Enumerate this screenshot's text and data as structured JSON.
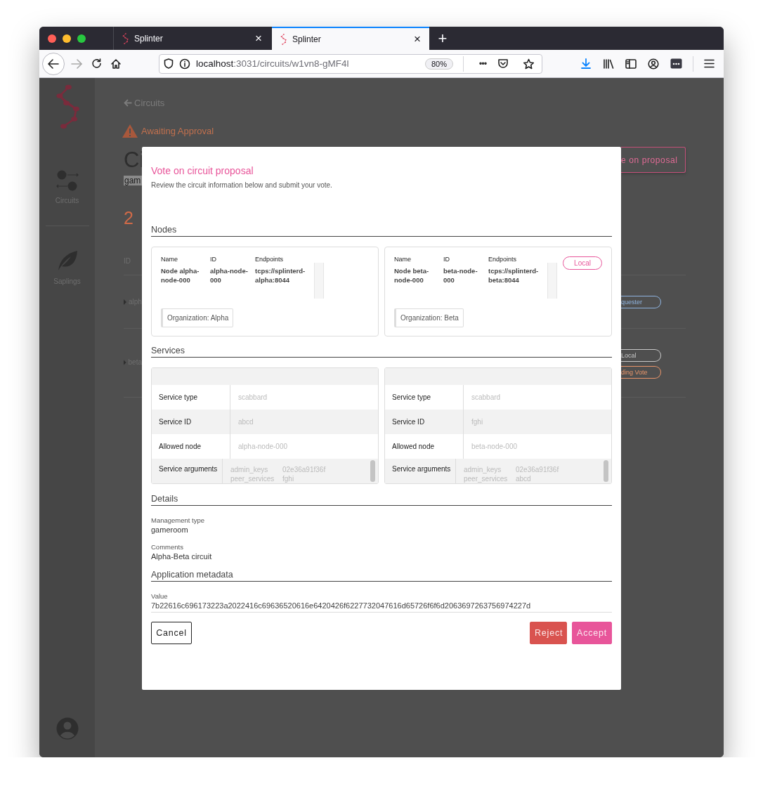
{
  "browser": {
    "tabs": [
      {
        "title": "Splinter",
        "selected": false,
        "close": "×"
      },
      {
        "title": "Splinter",
        "selected": true,
        "close": "×"
      }
    ],
    "new_tab": "+",
    "address": {
      "host": "localhost",
      "path": ":3031/circuits/w1vn8-gMF4l"
    },
    "zoom": "80%",
    "page_actions": "•••"
  },
  "sidebar": {
    "items": [
      {
        "label": "Circuits",
        "kind": "circuits"
      },
      {
        "label": "Saplings",
        "kind": "saplings"
      }
    ]
  },
  "page": {
    "back_link": "Circuits",
    "status": "Awaiting Approval",
    "title": "Ci",
    "subtitle": "gam",
    "count": "2",
    "action_button": "e on proposal",
    "table": {
      "column": "ID",
      "rows": [
        {
          "id": "alph",
          "badges": [
            {
              "label": "quester",
              "color": "#8fb4e0"
            }
          ]
        },
        {
          "id": "beta",
          "badges": [
            {
              "label": "Local",
              "color": "#c8c8c8"
            },
            {
              "label": "ding Vote",
              "color": "#e8956a"
            }
          ]
        }
      ]
    }
  },
  "dialog": {
    "title": "Vote on circuit proposal",
    "subtitle": "Review the circuit information below and submit your vote.",
    "nodes": {
      "heading": "Nodes",
      "items": [
        {
          "columns": [
            "Name",
            "ID",
            "Endpoints"
          ],
          "name": "Node alpha-node-000",
          "id": "alpha-node-000",
          "endpoint": "tcps://splinterd-alpha:8044",
          "organization": "Organization: Alpha"
        },
        {
          "columns": [
            "Name",
            "ID",
            "Endpoints"
          ],
          "name": "Node beta-node-000",
          "id": "beta-node-000",
          "endpoint": "tcps://splinterd-beta:8044",
          "organization": "Organization: Beta",
          "badge": "Local"
        }
      ]
    },
    "services": {
      "heading": "Services",
      "items": [
        {
          "rows": [
            {
              "kind": "text",
              "label": "Service type",
              "value": "scabbard"
            },
            {
              "kind": "text",
              "label": "Service ID",
              "value": "abcd"
            },
            {
              "kind": "text",
              "label": "Allowed node",
              "value": "alpha-node-000"
            },
            {
              "kind": "arguments",
              "label": "Service arguments",
              "arguments": [
                {
                  "key": "admin_keys",
                  "value": "02e36a91f36f"
                },
                {
                  "key": "peer_services",
                  "value": "fghi"
                }
              ]
            }
          ]
        },
        {
          "rows": [
            {
              "kind": "text",
              "label": "Service type",
              "value": "scabbard"
            },
            {
              "kind": "text",
              "label": "Service ID",
              "value": "fghi"
            },
            {
              "kind": "text",
              "label": "Allowed node",
              "value": "beta-node-000"
            },
            {
              "kind": "arguments",
              "label": "Service arguments",
              "arguments": [
                {
                  "key": "admin_keys",
                  "value": "02e36a91f36f"
                },
                {
                  "key": "peer_services",
                  "value": "abcd"
                }
              ]
            }
          ]
        }
      ]
    },
    "details": {
      "heading": "Details",
      "fields": [
        {
          "label": "Management type",
          "value": "gameroom"
        },
        {
          "label": "Comments",
          "value": "Alpha-Beta circuit"
        }
      ]
    },
    "metadata": {
      "heading": "Application metadata",
      "fields": [
        {
          "label": "Value",
          "value": "7b22616c696173223a2022416c69636520616e6420426f6227732047616d65726f6f6d2063697263756974227d"
        }
      ]
    },
    "buttons": [
      {
        "label": "Cancel",
        "kind": "outline"
      },
      {
        "label": "Reject",
        "kind": "danger"
      },
      {
        "label": "Accept",
        "kind": "primary"
      }
    ]
  }
}
